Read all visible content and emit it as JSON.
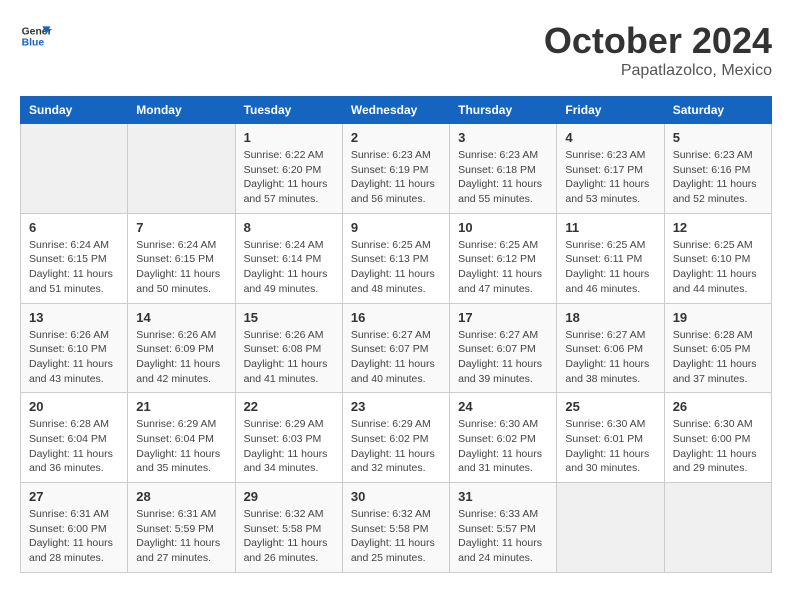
{
  "header": {
    "logo_line1": "General",
    "logo_line2": "Blue",
    "month": "October 2024",
    "location": "Papatlazolco, Mexico"
  },
  "days_of_week": [
    "Sunday",
    "Monday",
    "Tuesday",
    "Wednesday",
    "Thursday",
    "Friday",
    "Saturday"
  ],
  "weeks": [
    [
      {
        "day": "",
        "info": ""
      },
      {
        "day": "",
        "info": ""
      },
      {
        "day": "1",
        "info": "Sunrise: 6:22 AM\nSunset: 6:20 PM\nDaylight: 11 hours and 57 minutes."
      },
      {
        "day": "2",
        "info": "Sunrise: 6:23 AM\nSunset: 6:19 PM\nDaylight: 11 hours and 56 minutes."
      },
      {
        "day": "3",
        "info": "Sunrise: 6:23 AM\nSunset: 6:18 PM\nDaylight: 11 hours and 55 minutes."
      },
      {
        "day": "4",
        "info": "Sunrise: 6:23 AM\nSunset: 6:17 PM\nDaylight: 11 hours and 53 minutes."
      },
      {
        "day": "5",
        "info": "Sunrise: 6:23 AM\nSunset: 6:16 PM\nDaylight: 11 hours and 52 minutes."
      }
    ],
    [
      {
        "day": "6",
        "info": "Sunrise: 6:24 AM\nSunset: 6:15 PM\nDaylight: 11 hours and 51 minutes."
      },
      {
        "day": "7",
        "info": "Sunrise: 6:24 AM\nSunset: 6:15 PM\nDaylight: 11 hours and 50 minutes."
      },
      {
        "day": "8",
        "info": "Sunrise: 6:24 AM\nSunset: 6:14 PM\nDaylight: 11 hours and 49 minutes."
      },
      {
        "day": "9",
        "info": "Sunrise: 6:25 AM\nSunset: 6:13 PM\nDaylight: 11 hours and 48 minutes."
      },
      {
        "day": "10",
        "info": "Sunrise: 6:25 AM\nSunset: 6:12 PM\nDaylight: 11 hours and 47 minutes."
      },
      {
        "day": "11",
        "info": "Sunrise: 6:25 AM\nSunset: 6:11 PM\nDaylight: 11 hours and 46 minutes."
      },
      {
        "day": "12",
        "info": "Sunrise: 6:25 AM\nSunset: 6:10 PM\nDaylight: 11 hours and 44 minutes."
      }
    ],
    [
      {
        "day": "13",
        "info": "Sunrise: 6:26 AM\nSunset: 6:10 PM\nDaylight: 11 hours and 43 minutes."
      },
      {
        "day": "14",
        "info": "Sunrise: 6:26 AM\nSunset: 6:09 PM\nDaylight: 11 hours and 42 minutes."
      },
      {
        "day": "15",
        "info": "Sunrise: 6:26 AM\nSunset: 6:08 PM\nDaylight: 11 hours and 41 minutes."
      },
      {
        "day": "16",
        "info": "Sunrise: 6:27 AM\nSunset: 6:07 PM\nDaylight: 11 hours and 40 minutes."
      },
      {
        "day": "17",
        "info": "Sunrise: 6:27 AM\nSunset: 6:07 PM\nDaylight: 11 hours and 39 minutes."
      },
      {
        "day": "18",
        "info": "Sunrise: 6:27 AM\nSunset: 6:06 PM\nDaylight: 11 hours and 38 minutes."
      },
      {
        "day": "19",
        "info": "Sunrise: 6:28 AM\nSunset: 6:05 PM\nDaylight: 11 hours and 37 minutes."
      }
    ],
    [
      {
        "day": "20",
        "info": "Sunrise: 6:28 AM\nSunset: 6:04 PM\nDaylight: 11 hours and 36 minutes."
      },
      {
        "day": "21",
        "info": "Sunrise: 6:29 AM\nSunset: 6:04 PM\nDaylight: 11 hours and 35 minutes."
      },
      {
        "day": "22",
        "info": "Sunrise: 6:29 AM\nSunset: 6:03 PM\nDaylight: 11 hours and 34 minutes."
      },
      {
        "day": "23",
        "info": "Sunrise: 6:29 AM\nSunset: 6:02 PM\nDaylight: 11 hours and 32 minutes."
      },
      {
        "day": "24",
        "info": "Sunrise: 6:30 AM\nSunset: 6:02 PM\nDaylight: 11 hours and 31 minutes."
      },
      {
        "day": "25",
        "info": "Sunrise: 6:30 AM\nSunset: 6:01 PM\nDaylight: 11 hours and 30 minutes."
      },
      {
        "day": "26",
        "info": "Sunrise: 6:30 AM\nSunset: 6:00 PM\nDaylight: 11 hours and 29 minutes."
      }
    ],
    [
      {
        "day": "27",
        "info": "Sunrise: 6:31 AM\nSunset: 6:00 PM\nDaylight: 11 hours and 28 minutes."
      },
      {
        "day": "28",
        "info": "Sunrise: 6:31 AM\nSunset: 5:59 PM\nDaylight: 11 hours and 27 minutes."
      },
      {
        "day": "29",
        "info": "Sunrise: 6:32 AM\nSunset: 5:58 PM\nDaylight: 11 hours and 26 minutes."
      },
      {
        "day": "30",
        "info": "Sunrise: 6:32 AM\nSunset: 5:58 PM\nDaylight: 11 hours and 25 minutes."
      },
      {
        "day": "31",
        "info": "Sunrise: 6:33 AM\nSunset: 5:57 PM\nDaylight: 11 hours and 24 minutes."
      },
      {
        "day": "",
        "info": ""
      },
      {
        "day": "",
        "info": ""
      }
    ]
  ]
}
